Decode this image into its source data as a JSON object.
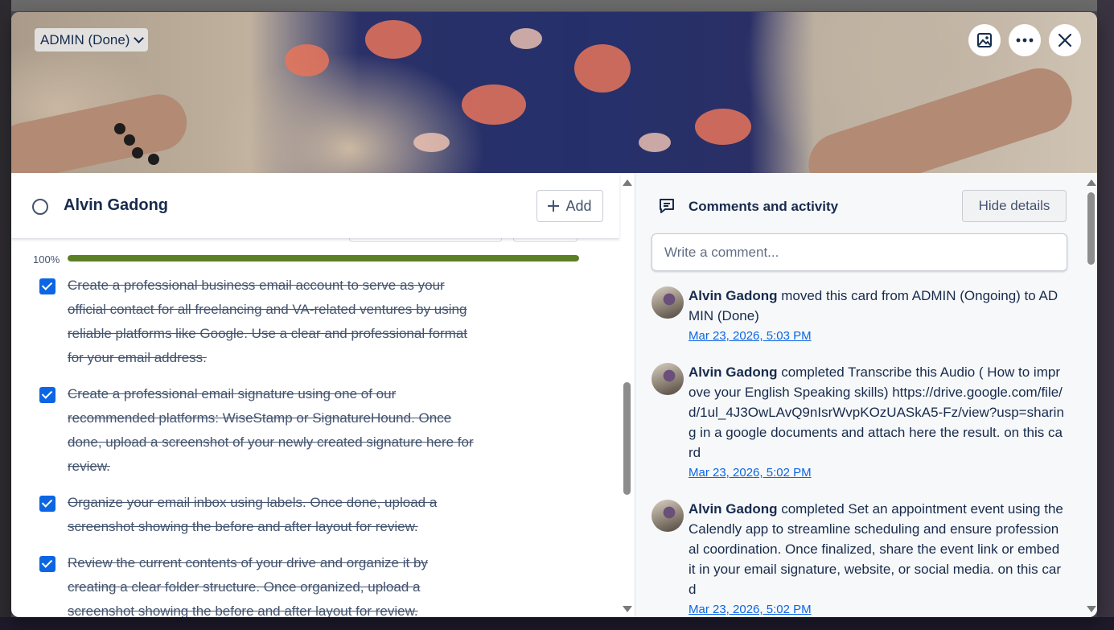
{
  "list_selector": {
    "label": "ADMIN (Done)"
  },
  "cover_actions": {
    "cover_icon": "image-icon",
    "more_icon": "ellipsis-icon",
    "close_icon": "close-icon"
  },
  "card": {
    "title": "Alvin Gadong",
    "add_label": "Add"
  },
  "checklist": {
    "progress_text": "100%",
    "progress_value": 1.0,
    "progress_color": "#5b7f24",
    "items": [
      {
        "text": "Create a professional business email account to serve as your official contact for all freelancing and VA-related ventures by using reliable platforms like Google. Use a clear and professional format for your email address.",
        "checked": true
      },
      {
        "text": "Create a professional email signature using one of our recommended platforms: WiseStamp or SignatureHound. Once done, upload a screenshot of your newly created signature here for review.",
        "checked": true
      },
      {
        "text": "Organize your email inbox using labels. Once done, upload a screenshot showing the before and after layout for review.",
        "checked": true
      },
      {
        "text": "Review the current contents of your drive and organize it by creating a clear folder structure. Once organized, upload a screenshot showing the before and after layout for review.",
        "checked": true
      }
    ]
  },
  "activity_panel": {
    "title": "Comments and activity",
    "hide_details_label": "Hide details",
    "comment_placeholder": "Write a comment...",
    "entries": [
      {
        "user": "Alvin Gadong",
        "text": " moved this card from ADMIN (Ongoing) to ADMIN (Done)",
        "time": "Mar 23, 2026, 5:03 PM"
      },
      {
        "user": "Alvin Gadong",
        "text": " completed Transcribe this Audio ( How to improve your English Speaking skills) https://drive.google.com/file/d/1ul_4J3OwLAvQ9nIsrWvpKOzUASkA5-Fz/view?usp=sharing in a google documents and attach here the result. on this card",
        "time": "Mar 23, 2026, 5:02 PM"
      },
      {
        "user": "Alvin Gadong",
        "text": " completed Set an appointment event using the Calendly app to streamline scheduling and ensure professional coordination. Once finalized, share the event link or embed it in your email signature, website, or social media. on this card",
        "time": "Mar 23, 2026, 5:02 PM"
      }
    ]
  },
  "colors": {
    "accent": "#0c66e4",
    "progress": "#5b7f24"
  }
}
